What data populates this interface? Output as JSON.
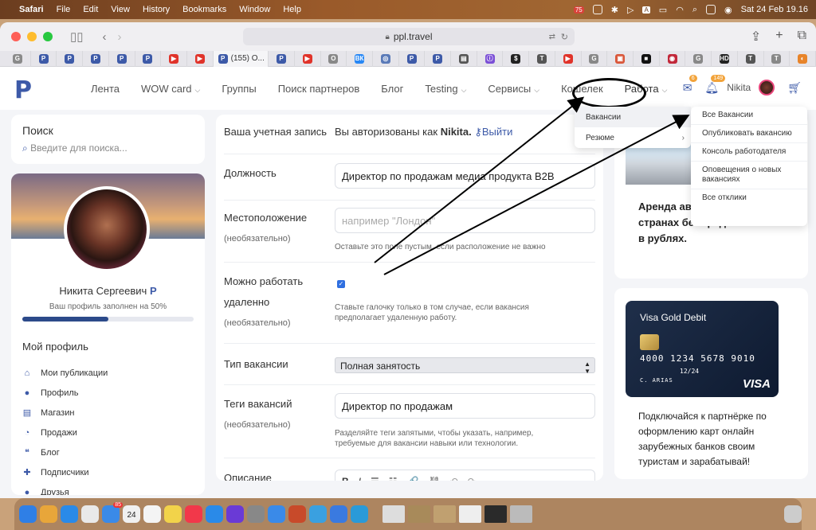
{
  "menubar": {
    "app": "Safari",
    "items": [
      "File",
      "Edit",
      "View",
      "History",
      "Bookmarks",
      "Window",
      "Help"
    ],
    "datetime": "Sat 24 Feb  19.16",
    "status_badge": "75"
  },
  "browser": {
    "url": "ppl.travel",
    "active_tab": "(155) О...",
    "tab_favicons": [
      "G",
      "Р",
      "Р",
      "Р",
      "Р",
      "Р",
      "▶",
      "▶",
      "Р",
      "▶",
      "О",
      "ВК",
      "◎",
      "Р",
      "Р",
      "▤",
      "ⓘ",
      "$",
      "Т",
      "▶",
      "G",
      "▣",
      "■",
      "◉",
      "G",
      "HD",
      "Т",
      "Т",
      "◐"
    ]
  },
  "site": {
    "logo": "Р",
    "nav": [
      "Лента",
      "WOW card",
      "Группы",
      "Поиск партнеров",
      "Блог",
      "Testing",
      "Сервисы",
      "Кошелек",
      "Работа"
    ],
    "mail_badge": "6",
    "bell_badge": "149",
    "user": "Nikita"
  },
  "sidebar": {
    "search_title": "Поиск",
    "search_placeholder": "Введите для поиска...",
    "name": "Никита Сергеевич",
    "profile_fill": "Ваш профиль заполнен на 50%",
    "profile_fill_value": 0.5,
    "my_profile": "Мой профиль",
    "items": [
      {
        "icon": "home-icon",
        "label": "Мои публикации",
        "glyph": "⌂"
      },
      {
        "icon": "user-icon",
        "label": "Профиль",
        "glyph": "●"
      },
      {
        "icon": "shop-icon",
        "label": "Магазин",
        "glyph": "▤"
      },
      {
        "icon": "speedometer-icon",
        "label": "Продажи",
        "glyph": "◔"
      },
      {
        "icon": "quote-icon",
        "label": "Блог",
        "glyph": "❝"
      },
      {
        "icon": "user-plus-icon",
        "label": "Подписчики",
        "glyph": "✚"
      },
      {
        "icon": "users-icon",
        "label": "Друзья",
        "glyph": "●"
      }
    ]
  },
  "form": {
    "account_label": "Ваша учетная запись",
    "account_text": "Вы авторизованы как",
    "account_name": "Nikita.",
    "logout": "Выйти",
    "position_label": "Должность",
    "position_value": "Директор по продажам медиа продукта B2B",
    "location_label": "Местоположение",
    "optional": "(необязательно)",
    "location_placeholder": "например \"Лондон\"",
    "location_help": "Оставьте это поле пустым, если расположение не важно",
    "remote_label_1": "Можно работать",
    "remote_label_2": "удаленно",
    "remote_help": "Ставьте галочку только в том случае, если вакансия предполагает удаленную работу.",
    "type_label": "Тип вакансии",
    "type_value": "Полная занятость",
    "tags_label": "Теги вакансий",
    "tags_value": "Директор по продажам",
    "tags_help": "Разделяйте теги запятыми, чтобы указать, например, требуемые для вакансии навыки или технологии.",
    "desc_label": "Описание",
    "editor_tools": [
      "B",
      "I",
      "☰",
      "☷",
      "🔗",
      "⛓",
      "↶",
      "↷"
    ]
  },
  "dropdown": {
    "level1": [
      "Вакансии",
      "Резюме"
    ],
    "level2": [
      "Все Вакансии",
      "Опубликовать вакансию",
      "Консоль работодателя",
      "Оповещения о новых вакансиях",
      "Все отклики"
    ]
  },
  "promo": {
    "car_text": "Аренда авто и мото в 100+ странах без кредитки. Оплата в рублях.",
    "card_title": "Visa Gold Debit",
    "card_number": "4000 1234 5678 9010",
    "card_exp": "12/24",
    "card_name": "C. ARIAS",
    "card_brand": "VISA",
    "card_text": "Подключайся к партнёрке по оформлению карт онлайн зарубежных банков своим туристам и зарабатывай!"
  },
  "dock": {
    "calendar_day": "24",
    "mail_badge": "85"
  },
  "colors": {
    "accent": "#3d5aa8",
    "badge": "#f2a33a",
    "checkbox": "#2f6fe0"
  }
}
